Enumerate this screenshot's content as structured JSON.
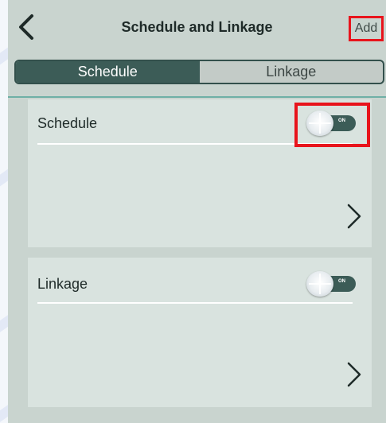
{
  "header": {
    "title": "Schedule and Linkage",
    "add_label": "Add"
  },
  "tabs": [
    {
      "label": "Schedule",
      "active": true
    },
    {
      "label": "Linkage",
      "active": false
    }
  ],
  "cards": [
    {
      "title": "Schedule",
      "toggle_text": "ON",
      "enabled": true
    },
    {
      "title": "Linkage",
      "toggle_text": "ON",
      "enabled": true
    }
  ],
  "colors": {
    "accent": "#3c5c57",
    "highlight": "#e8141c",
    "app_bg": "#c9d4cf",
    "card_bg": "#d9e3df"
  }
}
